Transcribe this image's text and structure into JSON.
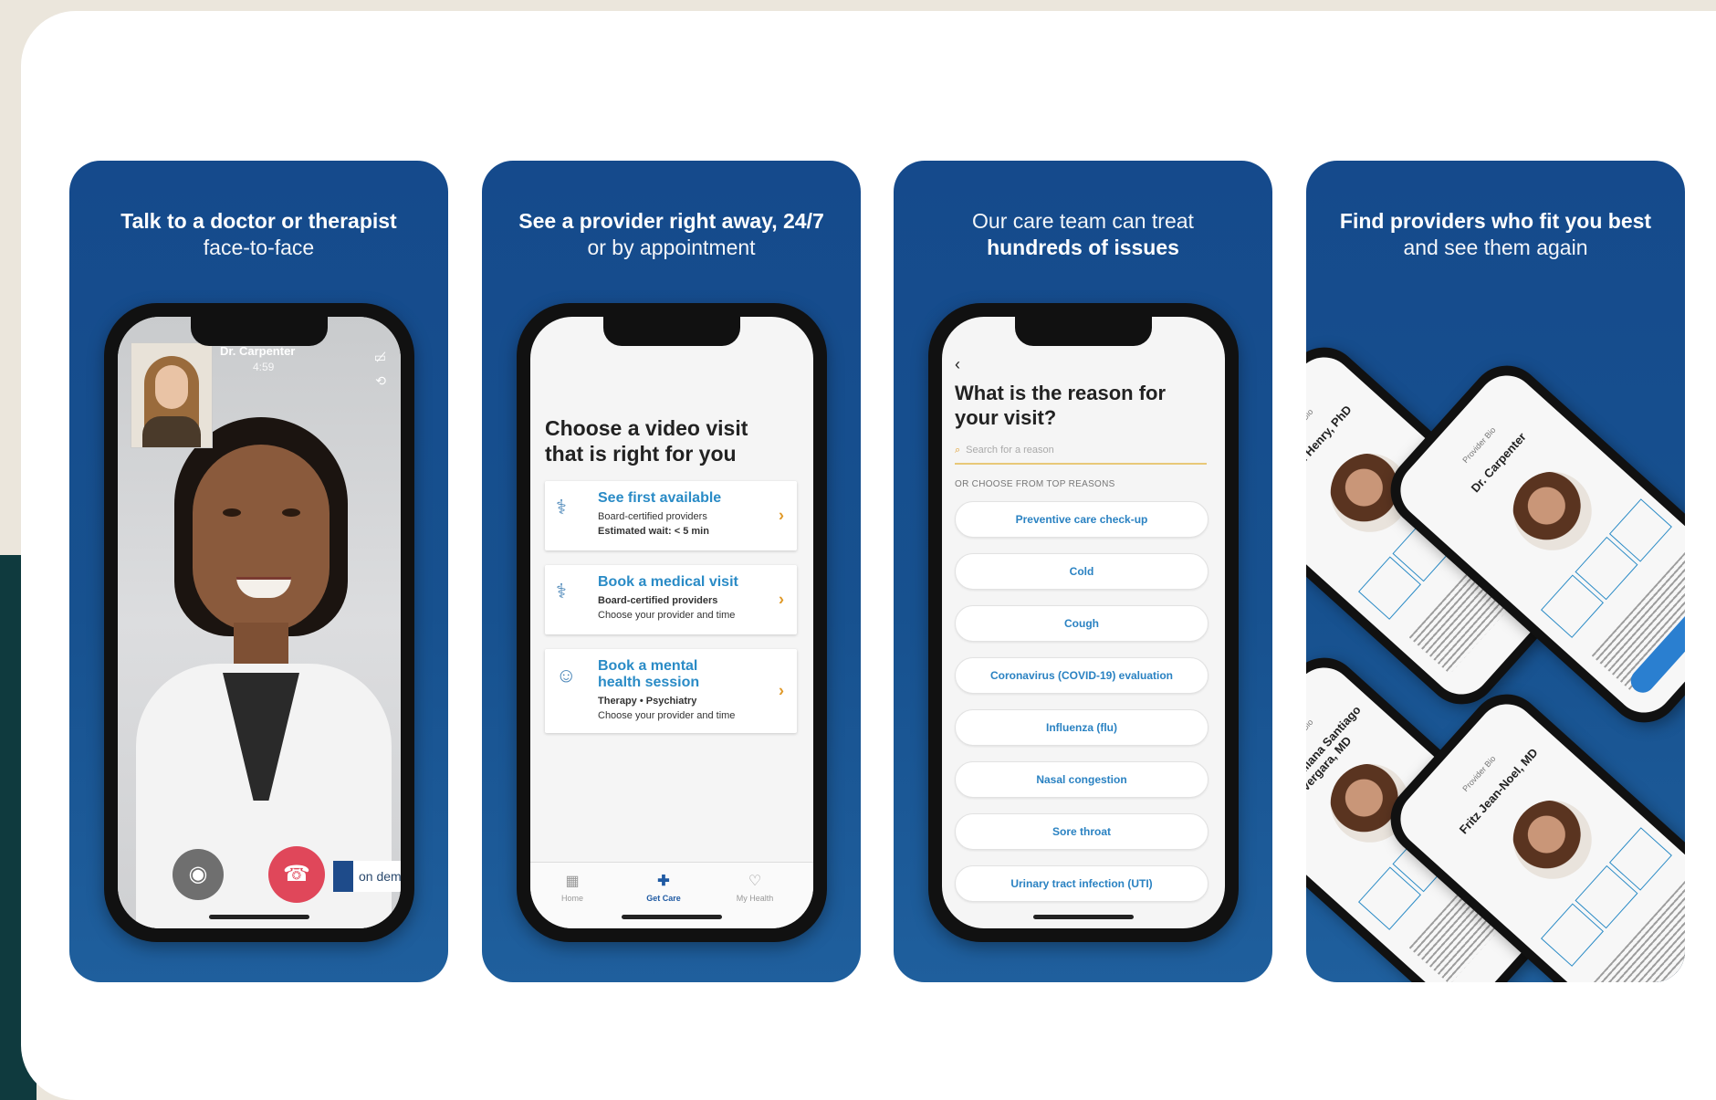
{
  "panels": [
    {
      "caption_bold": "Talk to a doctor or therapist",
      "caption_normal": "face-to-face",
      "call": {
        "name": "Dr. Carpenter",
        "time": "4:59",
        "brand_text": "on dema"
      }
    },
    {
      "caption_bold": "See a provider right away, 24/7",
      "caption_normal": "or by appointment",
      "screen_title": "Choose a video visit that is right for you",
      "options": [
        {
          "title": "See first available",
          "line1": "Board-certified providers",
          "line2": "Estimated wait: < 5 min"
        },
        {
          "title": "Book a medical visit",
          "line1": "Board-certified providers",
          "line2": "Choose your provider and time"
        },
        {
          "title": "Book a mental health session",
          "line1": "Therapy • Psychiatry",
          "line2": "Choose your provider and time"
        }
      ],
      "tabs": [
        "Home",
        "Get Care",
        "My Health"
      ]
    },
    {
      "caption_normal": "Our care team can treat",
      "caption_bold": "hundreds of issues",
      "screen_title": "What is the reason for your visit?",
      "search_placeholder": "Search for a reason",
      "section_label": "OR CHOOSE FROM TOP REASONS",
      "reasons": [
        "Preventive care check-up",
        "Cold",
        "Cough",
        "Coronavirus (COVID-19) evaluation",
        "Influenza (flu)",
        "Nasal congestion",
        "Sore throat",
        "Urinary tract infection (UTI)"
      ]
    },
    {
      "caption_bold": "Find providers who fit you best",
      "caption_normal": "and see them again",
      "providers": [
        {
          "label": "Provider Bio",
          "name": "Sarah Henry, PhD"
        },
        {
          "label": "Provider Bio",
          "name": "Dr. Carpenter"
        },
        {
          "label": "Provider Bio",
          "name": "Diana Liliana Santiago Vergara, MD"
        },
        {
          "label": "Provider Bio",
          "name": "Fritz Jean-Noel, MD"
        }
      ]
    }
  ]
}
